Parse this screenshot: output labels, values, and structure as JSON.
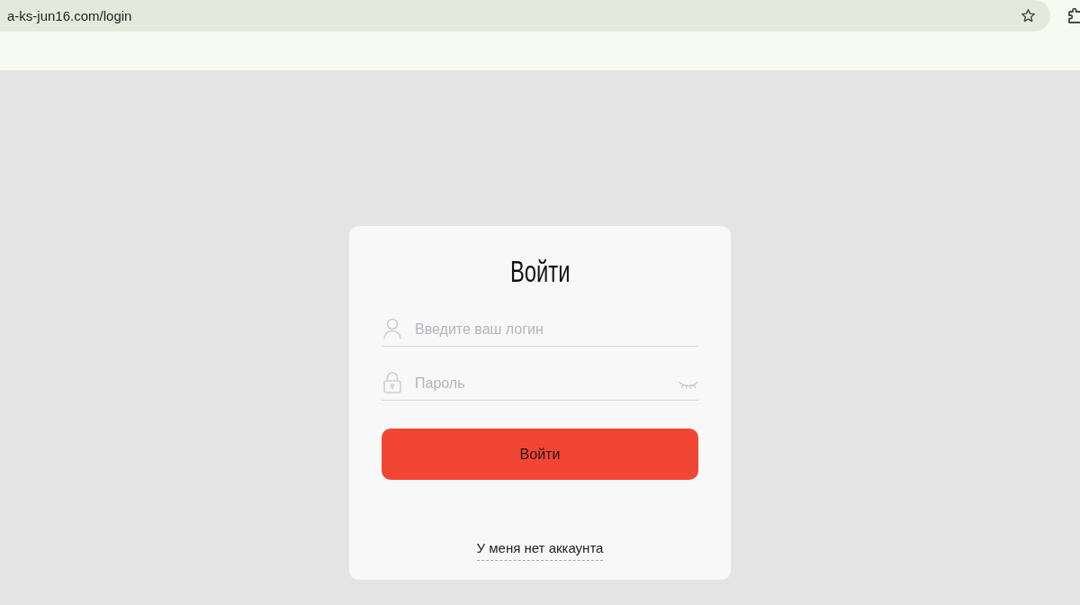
{
  "browser": {
    "url": "a-ks-jun16.com/login"
  },
  "login_form": {
    "title": "Войти",
    "fields": [
      {
        "kind": "text",
        "placeholder": "Введите ваш логин"
      },
      {
        "kind": "password",
        "placeholder": "Пароль"
      }
    ],
    "submit_button": "Войти",
    "signup_link": "У меня нет аккаунта"
  }
}
